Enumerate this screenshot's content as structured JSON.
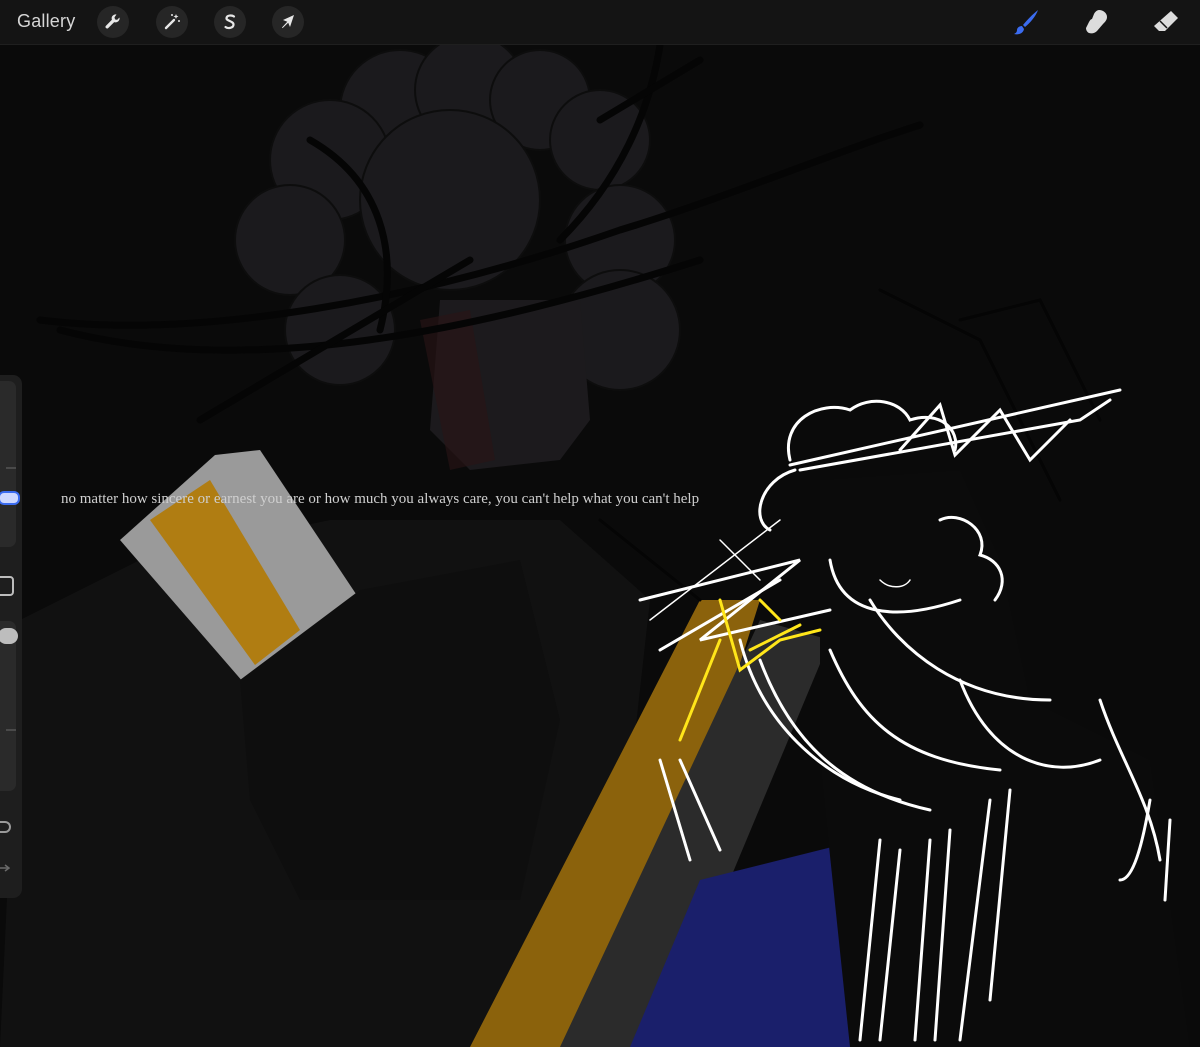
{
  "toolbar": {
    "gallery_label": "Gallery",
    "actions_icon": "wrench-icon",
    "adjustments_icon": "magic-wand-icon",
    "selection_icon": "selection-s-icon",
    "transform_icon": "arrow-cursor-icon",
    "brush_icon": "brush-icon",
    "smudge_icon": "smudge-finger-icon",
    "eraser_icon": "eraser-icon",
    "active_tool": "brush",
    "active_color": "#3b6cf0"
  },
  "canvas": {
    "overlay_text": "no matter how sincere or earnest you are or how much you always care, you can't help what you can't help",
    "colors": {
      "background": "#0a0a0a",
      "ochre": "#b07d12",
      "navy": "#1a1f6b",
      "white_linework": "#ffffff",
      "yellow_linework": "#ffe61a"
    }
  },
  "sidebar": {
    "brush_size_icon": "slider-icon",
    "modify_icon": "square-icon",
    "opacity_icon": "slider-icon",
    "undo_icon": "undo-icon",
    "redo_icon": "redo-icon"
  }
}
